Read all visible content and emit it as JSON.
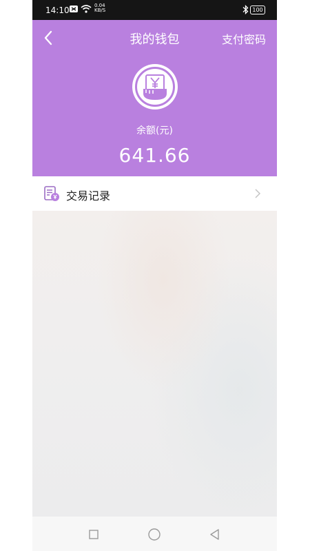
{
  "status_bar": {
    "time": "14:10",
    "net_speed_value": "0.04",
    "net_speed_unit": "KB/S",
    "battery": "100"
  },
  "header": {
    "title": "我的钱包",
    "right_action": "支付密码",
    "balance_label": "余额(元)",
    "balance_value": "641.66",
    "accent_color": "#b980df"
  },
  "menu": {
    "items": [
      {
        "label": "交易记录",
        "icon": "transaction-record-icon"
      }
    ]
  },
  "nav_bar": {
    "buttons": [
      "recent-apps-icon",
      "home-icon",
      "back-icon"
    ]
  }
}
